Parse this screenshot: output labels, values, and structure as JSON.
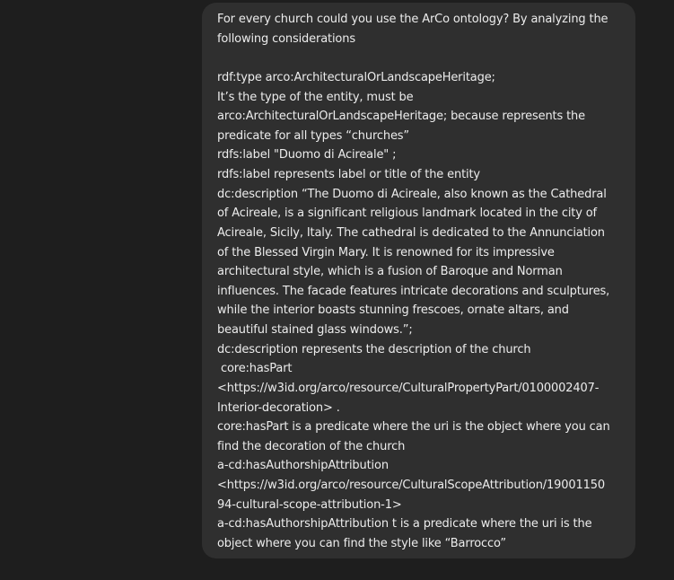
{
  "message": {
    "role": "user",
    "lines": [
      "For every church could you use the ArCo ontology? By analyzing the",
      "following considerations",
      "",
      "rdf:type arco:ArchitecturalOrLandscapeHeritage;",
      "It’s the type of the entity, must be",
      "arco:ArchitecturalOrLandscapeHeritage; because represents the",
      "predicate for all types “churches”",
      "rdfs:label \"Duomo di Acireale\" ;",
      "rdfs:label represents label or title of the entity",
      "dc:description “The Duomo di Acireale, also known as the Cathedral",
      "of Acireale, is a significant religious landmark located in the city of",
      "Acireale, Sicily, Italy. The cathedral is dedicated to the Annunciation",
      "of the Blessed Virgin Mary. It is renowned for its impressive",
      "architectural style, which is a fusion of Baroque and Norman",
      "influences. The facade features intricate decorations and sculptures,",
      "while the interior boasts stunning frescoes, ornate altars, and",
      "beautiful stained glass windows.”;",
      "dc:description represents the description of the church",
      " core:hasPart",
      "<https://w3id.org/arco/resource/CulturalPropertyPart/0100002407-",
      "Interior-decoration> .",
      "core:hasPart is a predicate where the uri is the object where you can",
      "find the decoration of the church",
      "a-cd:hasAuthorshipAttribution",
      "<https://w3id.org/arco/resource/CulturalScopeAttribution/19001150",
      "94-cultural-scope-attribution-1>",
      "a-cd:hasAuthorshipAttribution t is a predicate where the uri is the",
      "object where you can find the style like “Barrocco”"
    ]
  },
  "colors": {
    "page_background": "#1e1e1e",
    "bubble_background": "#2f2f2f",
    "text": "#ececec"
  }
}
